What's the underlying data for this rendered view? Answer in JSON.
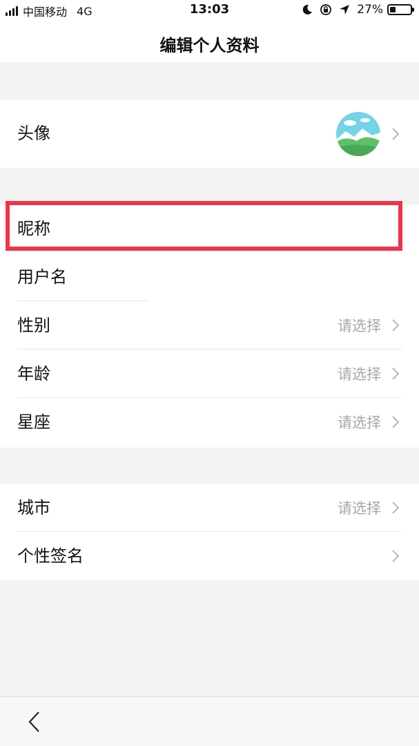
{
  "status_bar": {
    "carrier": "中国移动",
    "network": "4G",
    "time": "13:03",
    "battery": "27%",
    "battery_level": 0.27,
    "icons": [
      "moon-icon",
      "orientation-lock-icon",
      "location-arrow-icon",
      "battery-icon"
    ]
  },
  "header": {
    "title": "编辑个人资料"
  },
  "profile": {
    "avatar_label": "头像",
    "avatar_icon": "landscape-avatar-icon"
  },
  "basic_info": {
    "nickname_label": "昵称",
    "username_label": "用户名",
    "gender_label": "性别",
    "gender_value": "请选择",
    "age_label": "年龄",
    "age_value": "请选择",
    "zodiac_label": "星座",
    "zodiac_value": "请选择"
  },
  "extra_info": {
    "city_label": "城市",
    "city_value": "请选择",
    "signature_label": "个性签名"
  },
  "colors": {
    "highlight": "#f0324a",
    "background": "#f3f3f3",
    "placeholder": "#a7a7a7"
  },
  "bottom_bar": {
    "back_icon": "back-chevron-icon"
  }
}
